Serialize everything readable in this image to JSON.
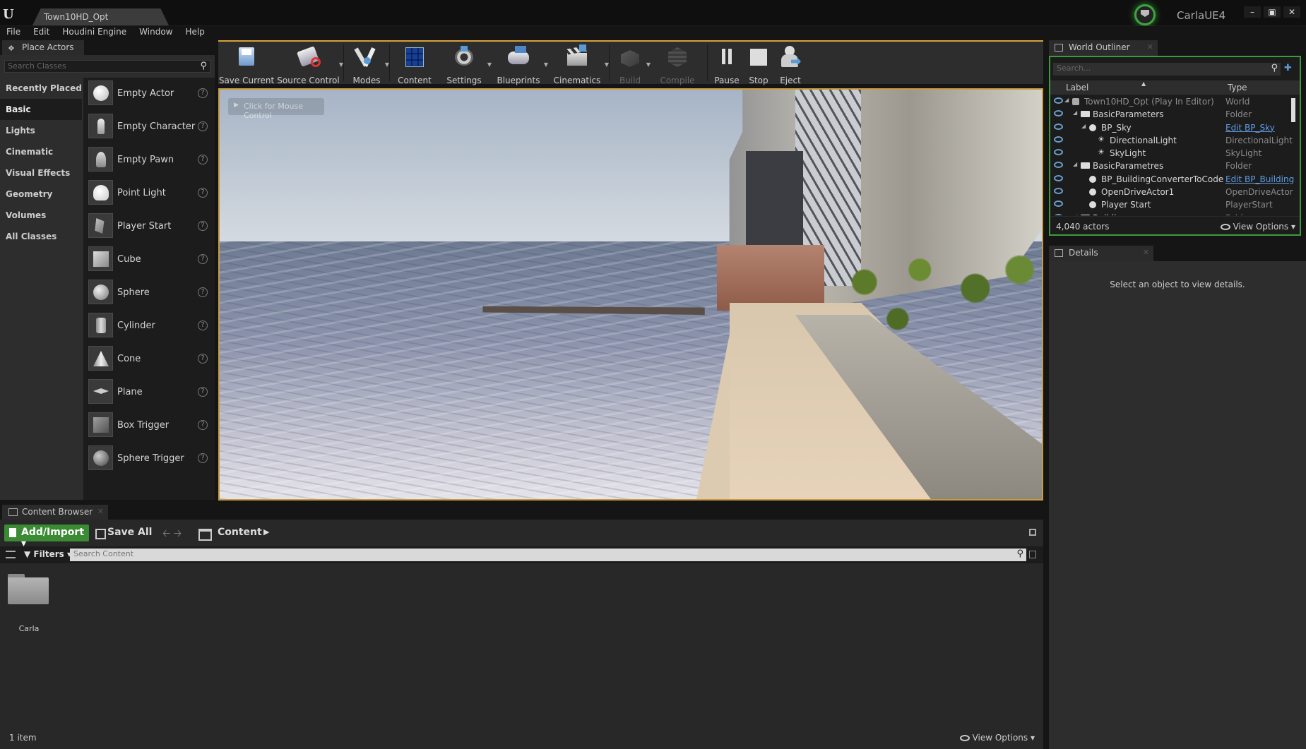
{
  "window": {
    "document_tab": "Town10HD_Opt",
    "project_name": "CarlaUE4",
    "controls": [
      "–",
      "▣",
      "✕"
    ]
  },
  "menu": [
    "File",
    "Edit",
    "Houdini Engine",
    "Window",
    "Help"
  ],
  "place_actors": {
    "tab_label": "Place Actors",
    "search_placeholder": "Search Classes",
    "categories": [
      "Recently Placed",
      "Basic",
      "Lights",
      "Cinematic",
      "Visual Effects",
      "Geometry",
      "Volumes",
      "All Classes"
    ],
    "selected_category": "Basic",
    "items": [
      {
        "label": "Empty Actor",
        "icon": "sphere-white-icon"
      },
      {
        "label": "Empty Character",
        "icon": "character-icon"
      },
      {
        "label": "Empty Pawn",
        "icon": "pawn-icon"
      },
      {
        "label": "Point Light",
        "icon": "bulb-icon"
      },
      {
        "label": "Player Start",
        "icon": "player-start-icon"
      },
      {
        "label": "Cube",
        "icon": "cube-icon"
      },
      {
        "label": "Sphere",
        "icon": "sphere-icon"
      },
      {
        "label": "Cylinder",
        "icon": "cylinder-icon"
      },
      {
        "label": "Cone",
        "icon": "cone-icon"
      },
      {
        "label": "Plane",
        "icon": "plane-icon"
      },
      {
        "label": "Box Trigger",
        "icon": "box-trigger-icon"
      },
      {
        "label": "Sphere Trigger",
        "icon": "sphere-trigger-icon"
      }
    ]
  },
  "toolbar": [
    {
      "label": "Save Current",
      "icon": "save-icon",
      "dropdown": false,
      "enabled": true
    },
    {
      "label": "Source Control",
      "icon": "source-control-icon",
      "dropdown": true,
      "enabled": true
    },
    {
      "label": "Modes",
      "icon": "modes-icon",
      "dropdown": true,
      "enabled": true
    },
    {
      "label": "Content",
      "icon": "content-icon",
      "dropdown": false,
      "enabled": true
    },
    {
      "label": "Settings",
      "icon": "settings-icon",
      "dropdown": true,
      "enabled": true
    },
    {
      "label": "Blueprints",
      "icon": "blueprints-icon",
      "dropdown": true,
      "enabled": true
    },
    {
      "label": "Cinematics",
      "icon": "cinematics-icon",
      "dropdown": true,
      "enabled": true
    },
    {
      "label": "Build",
      "icon": "build-icon",
      "dropdown": true,
      "enabled": false
    },
    {
      "label": "Compile",
      "icon": "compile-icon",
      "dropdown": false,
      "enabled": false
    },
    {
      "label": "Pause",
      "icon": "pause-icon",
      "dropdown": false,
      "enabled": true
    },
    {
      "label": "Stop",
      "icon": "stop-icon",
      "dropdown": false,
      "enabled": true
    },
    {
      "label": "Eject",
      "icon": "eject-icon",
      "dropdown": false,
      "enabled": true
    }
  ],
  "viewport": {
    "hint": "Click for Mouse Control"
  },
  "world_outliner": {
    "tab_label": "World Outliner",
    "search_placeholder": "Search...",
    "col_label": "Label",
    "col_type": "Type",
    "rows": [
      {
        "label": "Town10HD_Opt (Play In Editor)",
        "type": "World",
        "link": false,
        "kind": "world",
        "depth": 0,
        "expander": "◢",
        "dim": true
      },
      {
        "label": "BasicParameters",
        "type": "Folder",
        "link": false,
        "kind": "folder",
        "depth": 1,
        "expander": "◢",
        "dim": false
      },
      {
        "label": "BP_Sky",
        "type": "Edit BP_Sky",
        "link": true,
        "kind": "actor",
        "depth": 2,
        "expander": "◢",
        "dim": false
      },
      {
        "label": "DirectionalLight",
        "type": "DirectionalLight",
        "link": false,
        "kind": "light",
        "depth": 3,
        "expander": "",
        "dim": false
      },
      {
        "label": "SkyLight",
        "type": "SkyLight",
        "link": false,
        "kind": "light",
        "depth": 3,
        "expander": "",
        "dim": false
      },
      {
        "label": "BasicParametres",
        "type": "Folder",
        "link": false,
        "kind": "folder",
        "depth": 1,
        "expander": "◢",
        "dim": false
      },
      {
        "label": "BP_BuildingConverterToCode",
        "type": "Edit BP_Building",
        "link": true,
        "kind": "actor",
        "depth": 2,
        "expander": "",
        "dim": false
      },
      {
        "label": "OpenDriveActor1",
        "type": "OpenDriveActor",
        "link": false,
        "kind": "actor",
        "depth": 2,
        "expander": "",
        "dim": false
      },
      {
        "label": "Player Start",
        "type": "PlayerStart",
        "link": false,
        "kind": "actor",
        "depth": 2,
        "expander": "",
        "dim": false
      },
      {
        "label": "Buildings",
        "type": "Folder",
        "link": false,
        "kind": "folder",
        "depth": 1,
        "expander": "◢",
        "dim": false
      }
    ],
    "actor_count": "4,040 actors",
    "view_options": "View Options"
  },
  "details": {
    "tab_label": "Details",
    "empty_message": "Select an object to view details."
  },
  "content_browser": {
    "tab_label": "Content Browser",
    "add_import": "Add/Import",
    "save_all": "Save All",
    "breadcrumb": "Content",
    "filters": "Filters",
    "search_placeholder": "Search Content",
    "folders": [
      {
        "name": "Carla"
      }
    ],
    "item_count": "1 item",
    "view_options": "View Options"
  }
}
